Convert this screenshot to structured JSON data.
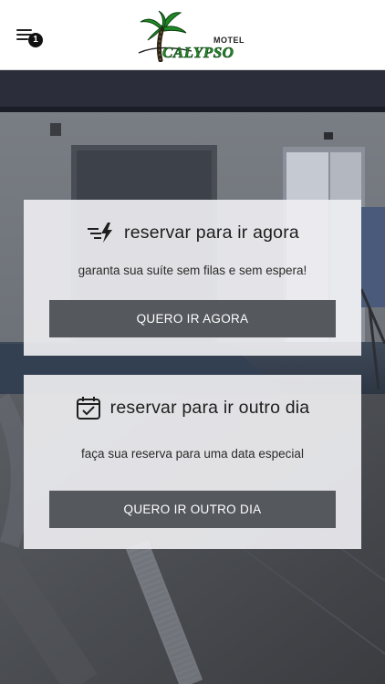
{
  "header": {
    "menu_badge": "1",
    "logo_motel": "MOTEL",
    "logo_calypso": "CALYPSO"
  },
  "cards": [
    {
      "icon": "fast-lightning-icon",
      "title": "reservar para ir agora",
      "subtitle": "garanta sua suíte sem filas e sem espera!",
      "button": "QUERO IR AGORA"
    },
    {
      "icon": "calendar-check-icon",
      "title": "reservar para ir outro dia",
      "subtitle": "faça sua reserva para uma data especial",
      "button": "QUERO IR OUTRO DIA"
    }
  ],
  "colors": {
    "button_bg": "#55585d",
    "card_bg": "#eeeef1",
    "logo_green": "#1f8a25"
  }
}
